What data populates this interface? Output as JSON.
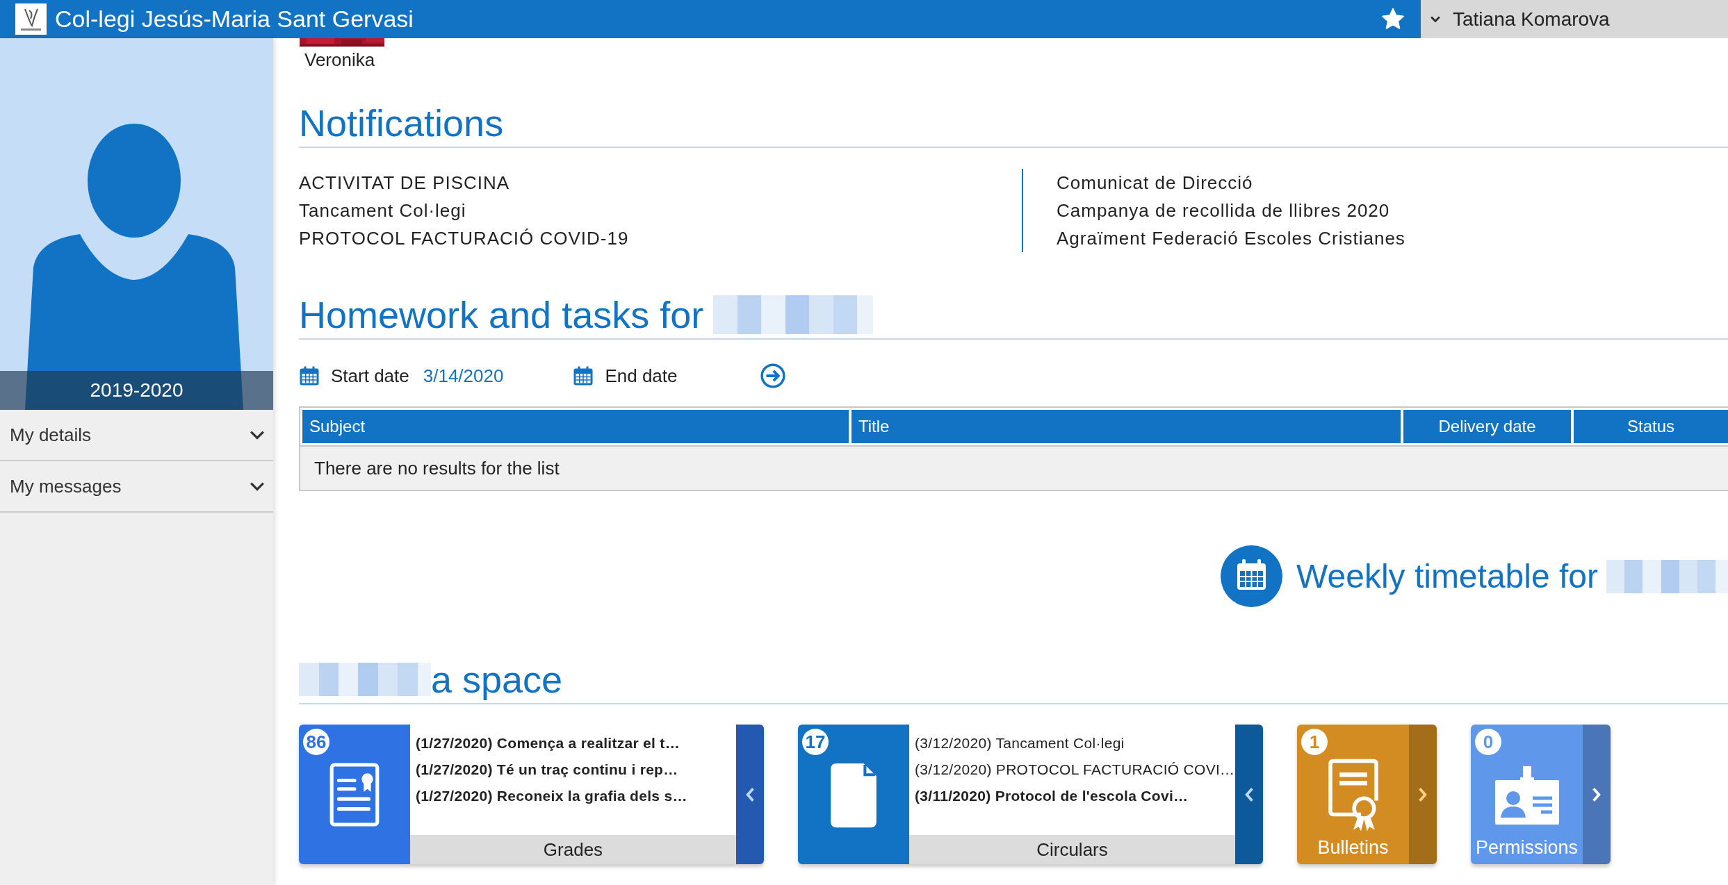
{
  "header": {
    "title": "Col-legi Jesús-Maria Sant Gervasi",
    "user": "Tatiana Komarova"
  },
  "sidebar": {
    "year": "2019-2020",
    "items": [
      {
        "label": "My details"
      },
      {
        "label": "My messages"
      }
    ]
  },
  "student": {
    "name": "Veronika"
  },
  "notifications": {
    "title": "Notifications",
    "left": [
      "ACTIVITAT DE PISCINA",
      "Tancament Col·legi",
      "PROTOCOL FACTURACIÓ COVID-19"
    ],
    "right": [
      "Comunicat de Direcció",
      "Campanya de recollida de llibres 2020",
      "Agraïment Federació Escoles Cristianes"
    ]
  },
  "homework": {
    "title": "Homework and tasks for",
    "start_label": "Start date",
    "start_value": "3/14/2020",
    "end_label": "End date",
    "table": {
      "columns": [
        "Subject",
        "Title",
        "Delivery date",
        "Status"
      ],
      "empty": "There are no results for the list"
    }
  },
  "timetable": {
    "title": "Weekly timetable for"
  },
  "space": {
    "title": "a space",
    "tiles": [
      {
        "kind": "list",
        "count": "86",
        "label": "Grades",
        "color": "#2f72e3",
        "items": [
          {
            "text": "(1/27/2020) Comença a realitzar el t…",
            "unread": true
          },
          {
            "text": "(1/27/2020) Té un traç continu i rep…",
            "unread": true
          },
          {
            "text": "(1/27/2020) Reconeix la grafia dels s…",
            "unread": true
          }
        ]
      },
      {
        "kind": "list",
        "count": "17",
        "label": "Circulars",
        "color": "#1273c4",
        "items": [
          {
            "text": "(3/12/2020) Tancament Col·legi",
            "unread": false
          },
          {
            "text": "(3/12/2020) PROTOCOL FACTURACIÓ COVI…",
            "unread": false
          },
          {
            "text": "(3/11/2020) Protocol de l'escola Covi…",
            "unread": true
          }
        ]
      },
      {
        "kind": "compact",
        "count": "1",
        "label": "Bulletins",
        "color": "#d38c22"
      },
      {
        "kind": "compact",
        "count": "0",
        "label": "Permissions",
        "color": "#5f97ea"
      }
    ]
  }
}
